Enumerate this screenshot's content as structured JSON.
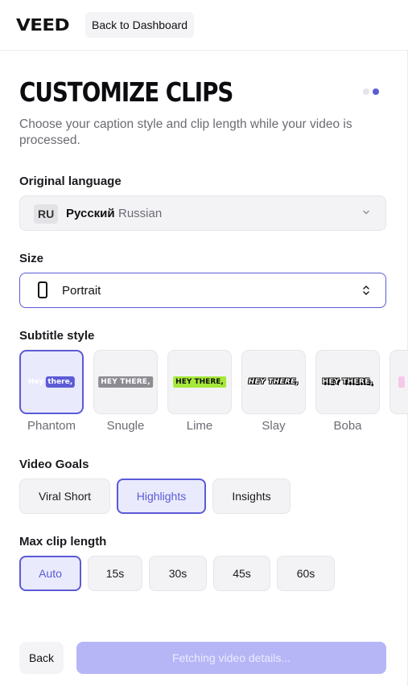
{
  "header": {
    "logo": "VEED",
    "back_to_dashboard": "Back to Dashboard"
  },
  "page": {
    "title": "CUSTOMIZE CLIPS",
    "subtitle": "Choose your caption style and clip length while your video is processed.",
    "steps": {
      "total": 2,
      "current": 2
    }
  },
  "language": {
    "label": "Original language",
    "code": "RU",
    "native_name": "Русский",
    "english_name": "Russian"
  },
  "size": {
    "label": "Size",
    "value": "Portrait",
    "icon": "portrait-icon"
  },
  "subtitle_style": {
    "label": "Subtitle style",
    "selected": "Phantom",
    "options": [
      {
        "name": "Phantom",
        "preview_word1": "Hey",
        "preview_word2": "there,"
      },
      {
        "name": "Snugle",
        "preview": "HEY THERE,"
      },
      {
        "name": "Lime",
        "preview": "HEY THERE,"
      },
      {
        "name": "Slay",
        "preview": "HEY THERE,"
      },
      {
        "name": "Boba",
        "preview": "HEY THERE,"
      }
    ]
  },
  "video_goals": {
    "label": "Video Goals",
    "selected": "Highlights",
    "options": [
      "Viral Short",
      "Highlights",
      "Insights"
    ]
  },
  "max_clip_length": {
    "label": "Max clip length",
    "selected": "Auto",
    "options": [
      "Auto",
      "15s",
      "30s",
      "45s",
      "60s"
    ]
  },
  "footer": {
    "back": "Back",
    "primary": "Fetching video details..."
  },
  "colors": {
    "accent": "#5b5bd6",
    "selected_bg": "#eaeafd",
    "primary_disabled": "#b6b6f7",
    "lime": "#a6e83a",
    "muted_text": "#6b6b74"
  }
}
